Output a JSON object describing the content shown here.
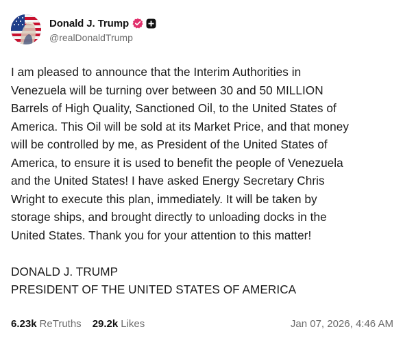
{
  "author": {
    "display_name": "Donald J. Trump",
    "handle": "@realDonaldTrump",
    "avatar_icon": "flag-portrait-avatar",
    "verified_icon": "verified-badge-icon",
    "verified_color": "#e1306c",
    "plus_icon": "plus-square-icon"
  },
  "post": {
    "lines": [
      "I am pleased to announce that the Interim Authorities in",
      "Venezuela will be turning over between 30 and 50 MILLION",
      "Barrels of High Quality, Sanctioned Oil, to the United States of",
      "America. This Oil will be sold at its Market Price, and that money",
      "will be controlled by me, as President of the United States of",
      "America, to ensure it is used to benefit the people of Venezuela",
      "and the United States! I have asked Energy Secretary Chris",
      "Wright to execute this plan, immediately. It will be taken by",
      "storage ships, and brought directly to unloading docks in the",
      "United States. Thank you for your attention to this matter!"
    ],
    "signature_name": "DONALD J. TRUMP",
    "signature_title": "PRESIDENT OF THE UNITED STATES OF AMERICA"
  },
  "stats": {
    "retruths_count": "6.23k",
    "retruths_label": "ReTruths",
    "likes_count": "29.2k",
    "likes_label": "Likes"
  },
  "timestamp": "Jan 07, 2026, 4:46 AM"
}
